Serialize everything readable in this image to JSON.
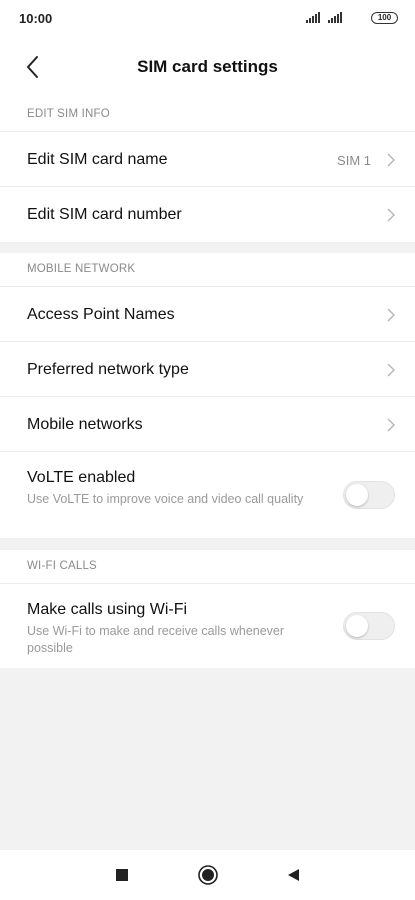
{
  "status_bar": {
    "time": "10:00",
    "battery": "100",
    "icons": [
      "signal-icon",
      "signal-icon",
      "battery-icon"
    ]
  },
  "header": {
    "title": "SIM card settings",
    "back_icon": "chevron-left-icon"
  },
  "sections": {
    "edit_sim_info": {
      "header": "EDIT SIM INFO",
      "items": [
        {
          "label": "Edit SIM card name",
          "value": "SIM 1"
        },
        {
          "label": "Edit SIM card number"
        }
      ]
    },
    "mobile_network": {
      "header": "MOBILE NETWORK",
      "items": [
        {
          "label": "Access Point Names"
        },
        {
          "label": "Preferred network type"
        },
        {
          "label": "Mobile networks"
        },
        {
          "label": "VoLTE enabled",
          "subtitle": "Use VoLTE to improve voice and video call quality",
          "toggle": false
        }
      ]
    },
    "wifi_calls": {
      "header": "WI-FI CALLS",
      "items": [
        {
          "label": "Make calls using Wi-Fi",
          "subtitle": "Use Wi-Fi to make and receive calls whenever possible",
          "toggle": false
        }
      ]
    }
  },
  "nav_bar": {
    "icons": [
      "recents-square-icon",
      "home-circle-icon",
      "back-triangle-icon"
    ]
  },
  "colors": {
    "background": "#f2f2f2",
    "surface": "#ffffff",
    "secondary_text": "#8a8a8a",
    "toggle_off": "#efefef"
  }
}
